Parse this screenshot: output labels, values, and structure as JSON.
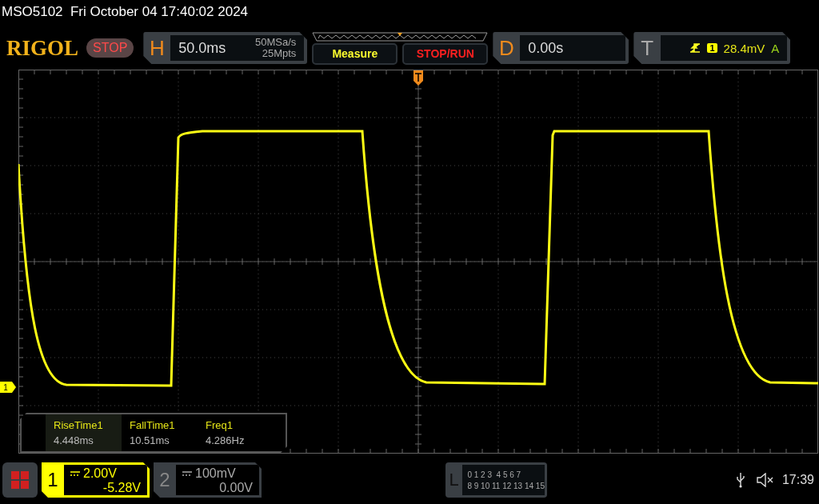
{
  "header": {
    "title": "MSO5102  Fri October 04 17:40:02 2024"
  },
  "toolbar": {
    "logo": "RIGOL",
    "run_state": "STOP",
    "horizontal": {
      "letter": "H",
      "scale": "50.0ms",
      "sample_rate": "50MSa/s",
      "memory_depth": "25Mpts"
    },
    "buttons": [
      {
        "label": "Measure",
        "kind": "measure"
      },
      {
        "label": "STOP/RUN",
        "kind": "run"
      }
    ],
    "delay": {
      "letter": "D",
      "value": "0.00s"
    },
    "trigger": {
      "letter": "T",
      "source": "1",
      "level": "28.4mV",
      "mode": "A"
    }
  },
  "screen": {
    "channel_marker": "1",
    "measurements": [
      {
        "name": "RiseTime1",
        "value": "4.448ms",
        "selected": true
      },
      {
        "name": "FallTime1",
        "value": "10.51ms",
        "selected": false
      },
      {
        "name": "Freq1",
        "value": "4.286Hz",
        "selected": false
      }
    ]
  },
  "bottom_bar": {
    "channels": [
      {
        "number": "1",
        "scale": "2.00V",
        "offset": "-5.28V",
        "active": true
      },
      {
        "number": "2",
        "scale": "100mV",
        "offset": "0.00V",
        "active": false
      }
    ],
    "logic": {
      "letter": "L",
      "rows": [
        "0 1 2 3  4 5 6 7",
        "8 9 10 11 12 13 14 15"
      ]
    },
    "time": "17:39"
  }
}
